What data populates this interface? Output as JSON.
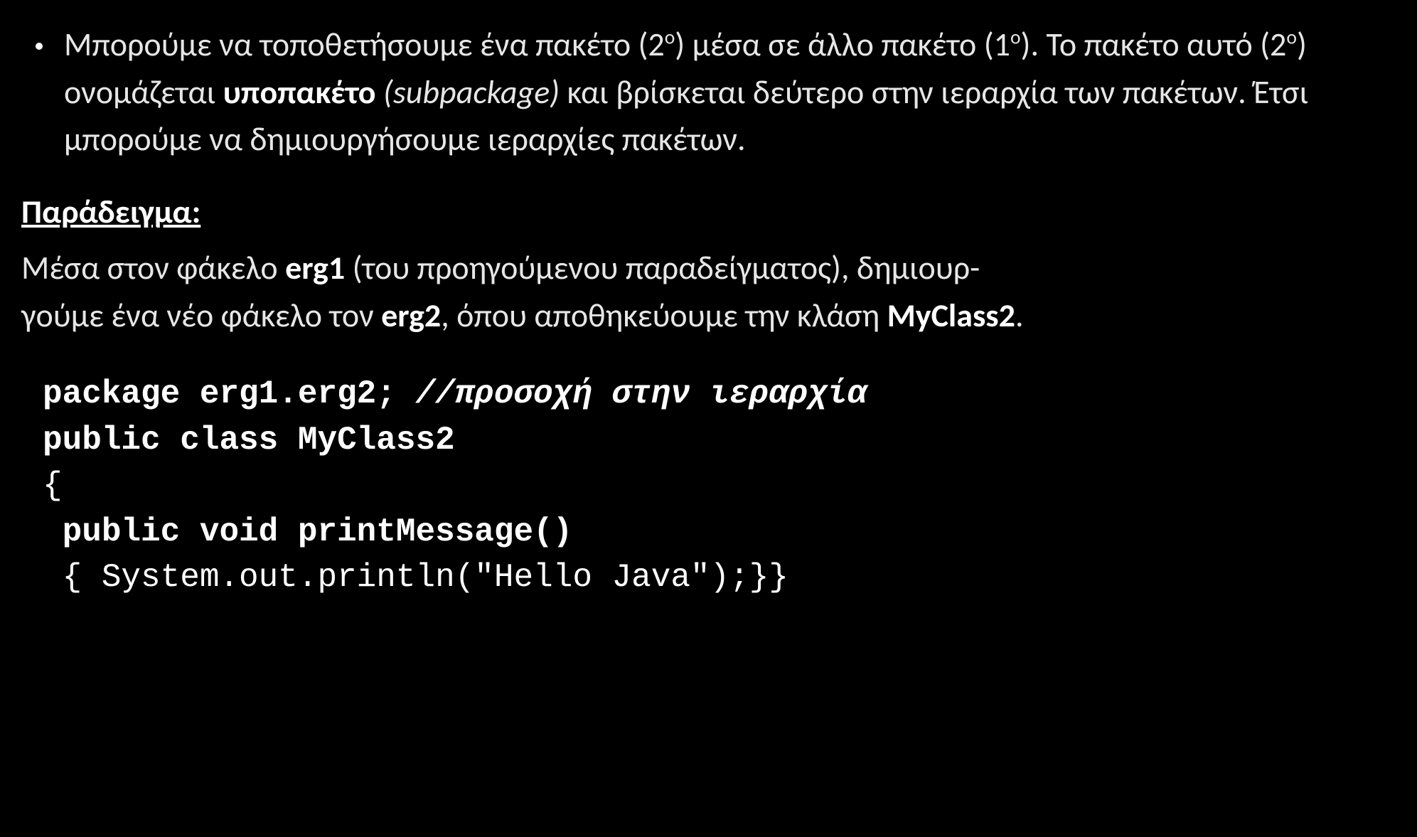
{
  "bullet": {
    "pre1": "Μπορούμε να τοποθετήσουμε ένα πακέτο (2",
    "sup1": "o",
    "mid1": ")  μέσα σε άλλο πακέτο (1",
    "sup2": "o",
    "mid2": "). Το πακέτο αυτό (2",
    "sup3": "o",
    "mid3": ") ονομάζεται ",
    "bold": "υποπακέτο",
    "italic": " (subpackage)",
    "rest": " και βρίσκεται δεύτερο στην ιεραρχία των πακέτων. Έτσι μπορούμε να δημιουργήσουμε ιεραρχίες πακέτων."
  },
  "exampleLabel": "Παράδειγμα:",
  "exampleBody": {
    "p1_pre": "Μέσα στον φάκελο ",
    "p1_b1": "erg1",
    "p1_mid": " (του προηγούμενου παραδείγματος), δημιουρ-",
    "p2_pre": "γούμε ένα νέο φάκελο τον ",
    "p2_b1": "erg2",
    "p2_mid": ", όπου αποθηκεύουμε την κλάση ",
    "p2_b2": "MyClass2",
    "p2_end": "."
  },
  "code": {
    "l1a": "package erg1.erg2;",
    "l1b": " //προσοχή στην ιεραρχία",
    "l2": "public class MyClass2",
    "l3": "{",
    "l4": " public void printMessage()",
    "l5": " { System.out.println(\"Hello Java\");}}"
  }
}
